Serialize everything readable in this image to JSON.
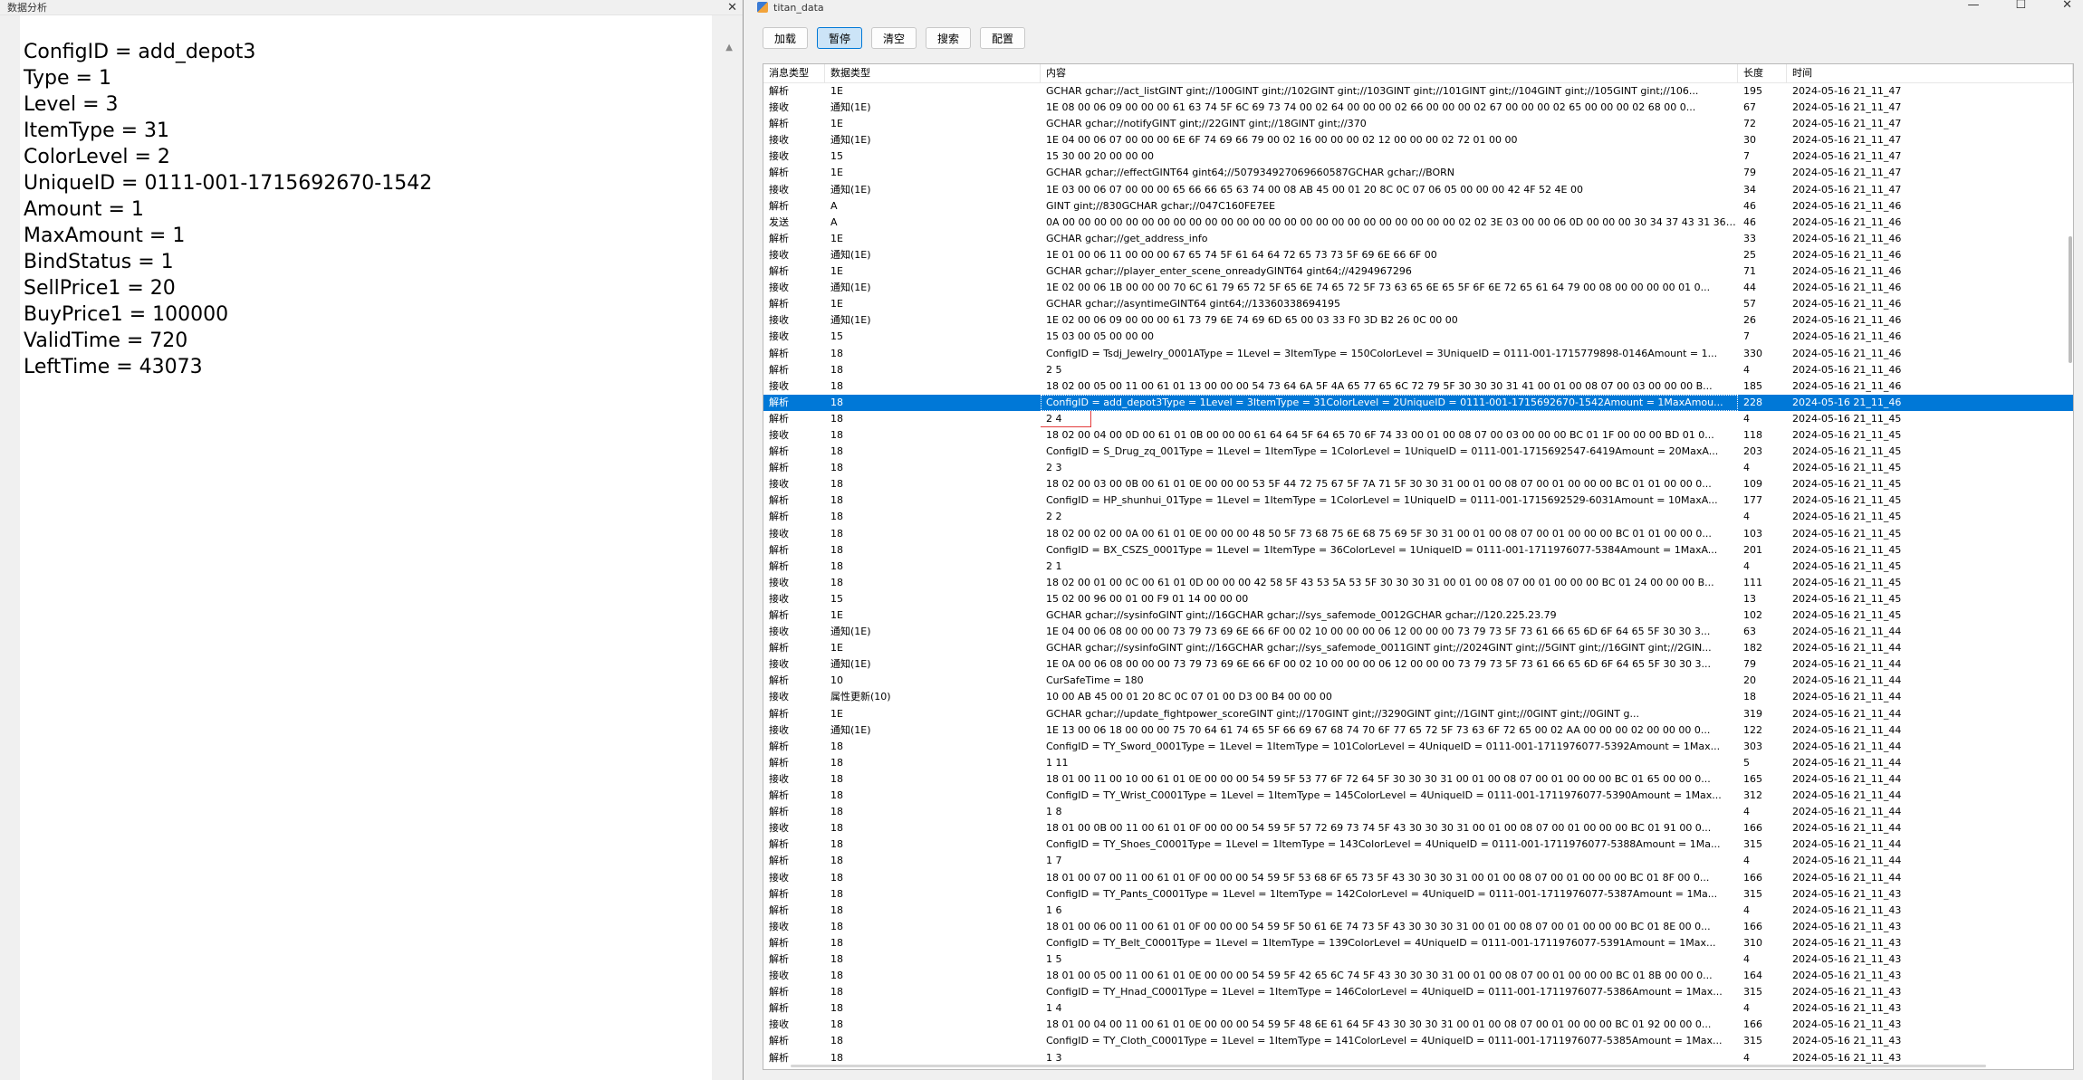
{
  "left_window": {
    "title": "数据分析",
    "lines": [
      "ConfigID = add_depot3",
      "Type = 1",
      "Level = 3",
      "ItemType = 31",
      "ColorLevel = 2",
      "UniqueID = 0111-001-1715692670-1542",
      "Amount = 1",
      "MaxAmount = 1",
      "BindStatus = 1",
      "SellPrice1 = 20",
      "BuyPrice1 = 100000",
      "ValidTime = 720",
      "LeftTime = 43073"
    ]
  },
  "right_window": {
    "title": "titan_data",
    "toolbar": {
      "load": "加载",
      "pause": "暂停",
      "clear": "清空",
      "search": "搜索",
      "config": "配置"
    },
    "columns": [
      "消息类型",
      "数据类型",
      "内容",
      "长度",
      "时间"
    ],
    "selected_index": 19,
    "boxed_index": 20,
    "rows": [
      [
        "解析",
        "1E",
        "GCHAR gchar;//act_listGINT gint;//100GINT gint;//102GINT gint;//103GINT gint;//101GINT gint;//104GINT gint;//105GINT gint;//106...",
        "195",
        "2024-05-16 21_11_47"
      ],
      [
        "接收",
        "通知(1E)",
        "1E 08 00 06 09 00 00 00 61 63 74 5F 6C 69 73 74 00 02 64 00 00 00 02 66 00 00 00 02 67 00 00 00 02 65 00 00 00 02 68 00 0...",
        "67",
        "2024-05-16 21_11_47"
      ],
      [
        "解析",
        "1E",
        "GCHAR gchar;//notifyGINT gint;//22GINT gint;//18GINT gint;//370",
        "72",
        "2024-05-16 21_11_47"
      ],
      [
        "接收",
        "通知(1E)",
        "1E 04 00 06 07 00 00 00 6E 6F 74 69 66 79 00 02 16 00 00 00 02 12 00 00 00 02 72 01 00 00",
        "30",
        "2024-05-16 21_11_47"
      ],
      [
        "接收",
        "15",
        "15 30 00 20 00 00 00",
        "7",
        "2024-05-16 21_11_47"
      ],
      [
        "解析",
        "1E",
        "GCHAR gchar;//effectGINT64 gint64;//507934927069660587GCHAR gchar;//BORN",
        "79",
        "2024-05-16 21_11_47"
      ],
      [
        "接收",
        "通知(1E)",
        "1E 03 00 06 07 00 00 00 65 66 66 65 63 74 00 08 AB 45 00 01 20 8C 0C 07 06 05 00 00 00 42 4F 52 4E 00",
        "34",
        "2024-05-16 21_11_47"
      ],
      [
        "解析",
        "A",
        "GINT gint;//830GCHAR gchar;//047C160FE7EE",
        "46",
        "2024-05-16 21_11_46"
      ],
      [
        "发送",
        "A",
        "0A 00 00 00 00 00 00 00 00 00 00 00 00 00 00 00 00 00 00 00 00 00 00 00 00 00 02 02 3E 03 00 00 06 0D 00 00 00 30 34 37 43 31 36 30 46 ...",
        "46",
        "2024-05-16 21_11_46"
      ],
      [
        "解析",
        "1E",
        "GCHAR gchar;//get_address_info",
        "33",
        "2024-05-16 21_11_46"
      ],
      [
        "接收",
        "通知(1E)",
        "1E 01 00 06 11 00 00 00 67 65 74 5F 61 64 64 72 65 73 73 5F 69 6E 66 6F 00",
        "25",
        "2024-05-16 21_11_46"
      ],
      [
        "解析",
        "1E",
        "GCHAR gchar;//player_enter_scene_onreadyGINT64 gint64;//4294967296",
        "71",
        "2024-05-16 21_11_46"
      ],
      [
        "接收",
        "通知(1E)",
        "1E 02 00 06 1B 00 00 00 70 6C 61 79 65 72 5F 65 6E 74 65 72 5F 73 63 65 6E 65 5F 6F 6E 72 65 61 64 79 00 08 00 00 00 00 01 0...",
        "44",
        "2024-05-16 21_11_46"
      ],
      [
        "解析",
        "1E",
        "GCHAR gchar;//asyntimeGINT64 gint64;//13360338694195",
        "57",
        "2024-05-16 21_11_46"
      ],
      [
        "接收",
        "通知(1E)",
        "1E 02 00 06 09 00 00 00 61 73 79 6E 74 69 6D 65 00 03 33 F0 3D B2 26 0C 00 00",
        "26",
        "2024-05-16 21_11_46"
      ],
      [
        "接收",
        "15",
        "15 03 00 05 00 00 00",
        "7",
        "2024-05-16 21_11_46"
      ],
      [
        "解析",
        "18",
        "ConfigID = Tsdj_Jewelry_0001AType = 1Level = 3ItemType = 150ColorLevel = 3UniqueID = 0111-001-1715779898-0146Amount = 1...",
        "330",
        "2024-05-16 21_11_46"
      ],
      [
        "解析",
        "18",
        "2 5",
        "4",
        "2024-05-16 21_11_46"
      ],
      [
        "接收",
        "18",
        "18 02 00 05 00 11 00 61 01 13 00 00 00 54 73 64 6A 5F 4A 65 77 65 6C 72 79 5F 30 30 30 31 41 00 01 00 08 07 00 03 00 00 00 B...",
        "185",
        "2024-05-16 21_11_46"
      ],
      [
        "解析",
        "18",
        "ConfigID = add_depot3Type = 1Level = 3ItemType = 31ColorLevel = 2UniqueID = 0111-001-1715692670-1542Amount = 1MaxAmou...",
        "228",
        "2024-05-16 21_11_46"
      ],
      [
        "解析",
        "18",
        "2 4",
        "4",
        "2024-05-16 21_11_45"
      ],
      [
        "接收",
        "18",
        "18 02 00 04 00 0D 00 61 01 0B 00 00 00 61 64 64 5F 64 65 70 6F 74 33 00 01 00 08 07 00 03 00 00 00 BC 01 1F 00 00 00 BD 01 0...",
        "118",
        "2024-05-16 21_11_45"
      ],
      [
        "解析",
        "18",
        "ConfigID = S_Drug_zq_001Type = 1Level = 1ItemType = 1ColorLevel = 1UniqueID = 0111-001-1715692547-6419Amount = 20MaxA...",
        "203",
        "2024-05-16 21_11_45"
      ],
      [
        "解析",
        "18",
        "2 3",
        "4",
        "2024-05-16 21_11_45"
      ],
      [
        "接收",
        "18",
        "18 02 00 03 00 0B 00 61 01 0E 00 00 00 53 5F 44 72 75 67 5F 7A 71 5F 30 30 31 00 01 00 08 07 00 01 00 00 00 BC 01 01 00 00 0...",
        "109",
        "2024-05-16 21_11_45"
      ],
      [
        "解析",
        "18",
        "ConfigID = HP_shunhui_01Type = 1Level = 1ItemType = 1ColorLevel = 1UniqueID = 0111-001-1715692529-6031Amount = 10MaxA...",
        "177",
        "2024-05-16 21_11_45"
      ],
      [
        "解析",
        "18",
        "2 2",
        "4",
        "2024-05-16 21_11_45"
      ],
      [
        "接收",
        "18",
        "18 02 00 02 00 0A 00 61 01 0E 00 00 00 48 50 5F 73 68 75 6E 68 75 69 5F 30 31 00 01 00 08 07 00 01 00 00 00 BC 01 01 00 00 0...",
        "103",
        "2024-05-16 21_11_45"
      ],
      [
        "解析",
        "18",
        "ConfigID = BX_CSZS_0001Type = 1Level = 1ItemType = 36ColorLevel = 1UniqueID = 0111-001-1711976077-5384Amount = 1MaxA...",
        "201",
        "2024-05-16 21_11_45"
      ],
      [
        "解析",
        "18",
        "2 1",
        "4",
        "2024-05-16 21_11_45"
      ],
      [
        "接收",
        "18",
        "18 02 00 01 00 0C 00 61 01 0D 00 00 00 42 58 5F 43 53 5A 53 5F 30 30 30 31 00 01 00 08 07 00 01 00 00 00 BC 01 24 00 00 00 B...",
        "111",
        "2024-05-16 21_11_45"
      ],
      [
        "接收",
        "15",
        "15 02 00 96 00 01 00 F9 01 14 00 00 00",
        "13",
        "2024-05-16 21_11_45"
      ],
      [
        "解析",
        "1E",
        "GCHAR gchar;//sysinfoGINT gint;//16GCHAR gchar;//sys_safemode_0012GCHAR gchar;//120.225.23.79",
        "102",
        "2024-05-16 21_11_45"
      ],
      [
        "接收",
        "通知(1E)",
        "1E 04 00 06 08 00 00 00 73 79 73 69 6E 66 6F 00 02 10 00 00 00 06 12 00 00 00 73 79 73 5F 73 61 66 65 6D 6F 64 65 5F 30 30 3...",
        "63",
        "2024-05-16 21_11_44"
      ],
      [
        "解析",
        "1E",
        "GCHAR gchar;//sysinfoGINT gint;//16GCHAR gchar;//sys_safemode_0011GINT gint;//2024GINT gint;//5GINT gint;//16GINT gint;//2GIN...",
        "182",
        "2024-05-16 21_11_44"
      ],
      [
        "接收",
        "通知(1E)",
        "1E 0A 00 06 08 00 00 00 73 79 73 69 6E 66 6F 00 02 10 00 00 00 06 12 00 00 00 73 79 73 5F 73 61 66 65 6D 6F 64 65 5F 30 30 3...",
        "79",
        "2024-05-16 21_11_44"
      ],
      [
        "解析",
        "10",
        "CurSafeTime = 180",
        "20",
        "2024-05-16 21_11_44"
      ],
      [
        "接收",
        "属性更新(10)",
        "10 00 AB 45 00 01 20 8C 0C 07 01 00 D3 00 B4 00 00 00",
        "18",
        "2024-05-16 21_11_44"
      ],
      [
        "解析",
        "1E",
        "GCHAR gchar;//update_fightpower_scoreGINT gint;//170GINT gint;//3290GINT gint;//1GINT gint;//0GINT gint;//0GINT g...",
        "319",
        "2024-05-16 21_11_44"
      ],
      [
        "接收",
        "通知(1E)",
        "1E 13 00 06 18 00 00 00 75 70 64 61 74 65 5F 66 69 67 68 74 70 6F 77 65 72 5F 73 63 6F 72 65 00 02 AA 00 00 00 02 00 00 00 0...",
        "122",
        "2024-05-16 21_11_44"
      ],
      [
        "解析",
        "18",
        "ConfigID = TY_Sword_0001Type = 1Level = 1ItemType = 101ColorLevel = 4UniqueID = 0111-001-1711976077-5392Amount = 1Max...",
        "303",
        "2024-05-16 21_11_44"
      ],
      [
        "解析",
        "18",
        "1 11",
        "5",
        "2024-05-16 21_11_44"
      ],
      [
        "接收",
        "18",
        "18 01 00 11 00 10 00 61 01 0E 00 00 00 54 59 5F 53 77 6F 72 64 5F 30 30 30 31 00 01 00 08 07 00 01 00 00 00 BC 01 65 00 00 0...",
        "165",
        "2024-05-16 21_11_44"
      ],
      [
        "解析",
        "18",
        "ConfigID = TY_Wrist_C0001Type = 1Level = 1ItemType = 145ColorLevel = 4UniqueID = 0111-001-1711976077-5390Amount = 1Max...",
        "312",
        "2024-05-16 21_11_44"
      ],
      [
        "解析",
        "18",
        "1 8",
        "4",
        "2024-05-16 21_11_44"
      ],
      [
        "接收",
        "18",
        "18 01 00 0B 00 11 00 61 01 0F 00 00 00 54 59 5F 57 72 69 73 74 5F 43 30 30 30 31 00 01 00 08 07 00 01 00 00 00 BC 01 91 00 0...",
        "166",
        "2024-05-16 21_11_44"
      ],
      [
        "解析",
        "18",
        "ConfigID = TY_Shoes_C0001Type = 1Level = 1ItemType = 143ColorLevel = 4UniqueID = 0111-001-1711976077-5388Amount = 1Ma...",
        "315",
        "2024-05-16 21_11_44"
      ],
      [
        "解析",
        "18",
        "1 7",
        "4",
        "2024-05-16 21_11_44"
      ],
      [
        "接收",
        "18",
        "18 01 00 07 00 11 00 61 01 0F 00 00 00 54 59 5F 53 68 6F 65 73 5F 43 30 30 30 31 00 01 00 08 07 00 01 00 00 00 BC 01 8F 00 0...",
        "166",
        "2024-05-16 21_11_44"
      ],
      [
        "解析",
        "18",
        "ConfigID = TY_Pants_C0001Type = 1Level = 1ItemType = 142ColorLevel = 4UniqueID = 0111-001-1711976077-5387Amount = 1Ma...",
        "315",
        "2024-05-16 21_11_43"
      ],
      [
        "解析",
        "18",
        "1 6",
        "4",
        "2024-05-16 21_11_43"
      ],
      [
        "接收",
        "18",
        "18 01 00 06 00 11 00 61 01 0F 00 00 00 54 59 5F 50 61 6E 74 73 5F 43 30 30 30 31 00 01 00 08 07 00 01 00 00 00 BC 01 8E 00 0...",
        "166",
        "2024-05-16 21_11_43"
      ],
      [
        "解析",
        "18",
        "ConfigID = TY_Belt_C0001Type = 1Level = 1ItemType = 139ColorLevel = 4UniqueID = 0111-001-1711976077-5391Amount = 1Max...",
        "310",
        "2024-05-16 21_11_43"
      ],
      [
        "解析",
        "18",
        "1 5",
        "4",
        "2024-05-16 21_11_43"
      ],
      [
        "接收",
        "18",
        "18 01 00 05 00 11 00 61 01 0E 00 00 00 54 59 5F 42 65 6C 74 5F 43 30 30 30 31 00 01 00 08 07 00 01 00 00 00 BC 01 8B 00 00 0...",
        "164",
        "2024-05-16 21_11_43"
      ],
      [
        "解析",
        "18",
        "ConfigID = TY_Hnad_C0001Type = 1Level = 1ItemType = 146ColorLevel = 4UniqueID = 0111-001-1711976077-5386Amount = 1Max...",
        "315",
        "2024-05-16 21_11_43"
      ],
      [
        "解析",
        "18",
        "1 4",
        "4",
        "2024-05-16 21_11_43"
      ],
      [
        "接收",
        "18",
        "18 01 00 04 00 11 00 61 01 0E 00 00 00 54 59 5F 48 6E 61 64 5F 43 30 30 30 31 00 01 00 08 07 00 01 00 00 00 BC 01 92 00 00 0...",
        "166",
        "2024-05-16 21_11_43"
      ],
      [
        "解析",
        "18",
        "ConfigID = TY_Cloth_C0001Type = 1Level = 1ItemType = 141ColorLevel = 4UniqueID = 0111-001-1711976077-5385Amount = 1Max...",
        "315",
        "2024-05-16 21_11_43"
      ],
      [
        "解析",
        "18",
        "1 3",
        "4",
        "2024-05-16 21_11_43"
      ]
    ]
  }
}
